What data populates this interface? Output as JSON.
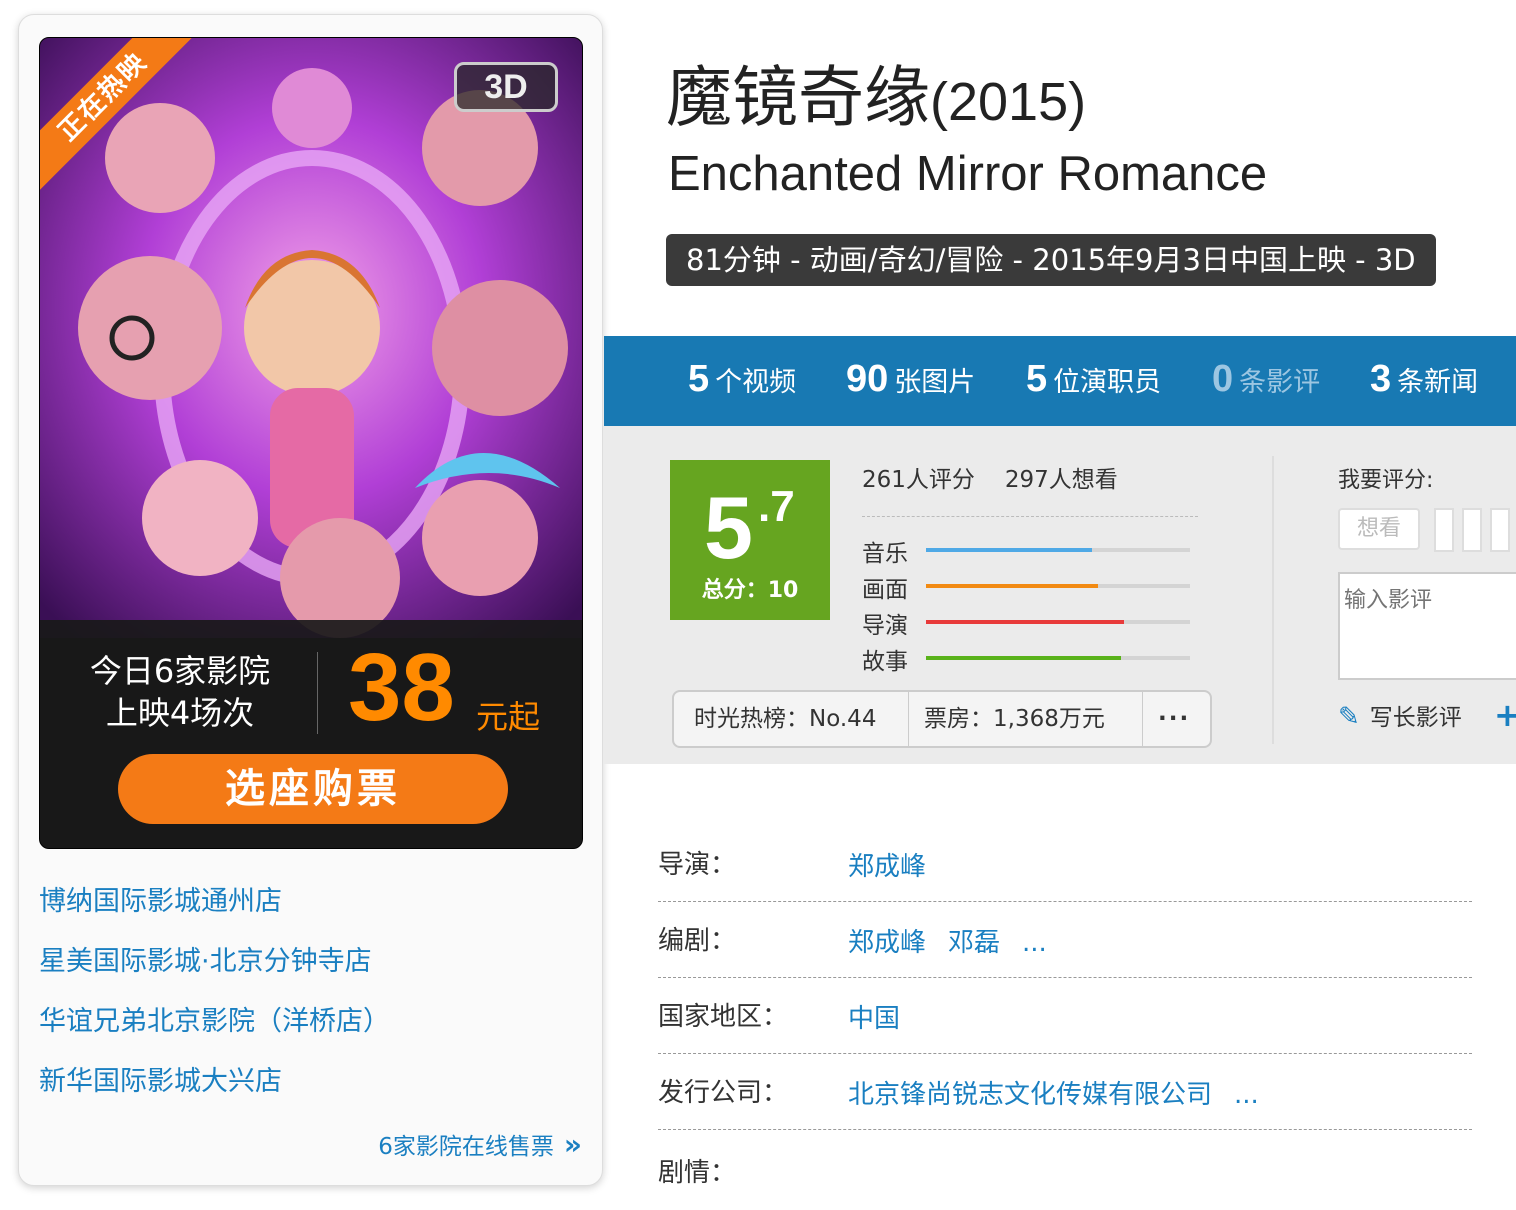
{
  "poster": {
    "ribbon": "正在热映",
    "badge": "3D",
    "showtime_line1": "今日6家影院",
    "showtime_line2": "上映4场次",
    "price": "38",
    "price_suffix": "元起",
    "buy_label": "选座购票"
  },
  "cinemas": [
    "博纳国际影城通州店",
    "星美国际影城·北京分钟寺店",
    "华谊兄弟北京影院（洋桥店）",
    "新华国际影城大兴店"
  ],
  "more_cinemas": "6家影院在线售票",
  "movie": {
    "title_cn": "魔镜奇缘",
    "year": "(2015)",
    "title_en": "Enchanted Mirror Romance",
    "meta": "81分钟 - 动画/奇幻/冒险 - 2015年9月3日中国上映 - 3D"
  },
  "stats": [
    {
      "num": "5",
      "label": "个视频"
    },
    {
      "num": "90",
      "label": "张图片"
    },
    {
      "num": "5",
      "label": "位演职员"
    },
    {
      "num": "0",
      "label": "条影评"
    },
    {
      "num": "3",
      "label": "条新闻"
    }
  ],
  "rating": {
    "score_int": "5",
    "score_dec": ".7",
    "total": "总分：10",
    "raters": "261人评分",
    "wants": "297人想看",
    "bars": [
      {
        "label": "音乐",
        "fraction": 0.63,
        "color": "#4fa9e6"
      },
      {
        "label": "画面",
        "fraction": 0.65,
        "color": "#f28a12"
      },
      {
        "label": "导演",
        "fraction": 0.75,
        "color": "#e83a3a"
      },
      {
        "label": "故事",
        "fraction": 0.74,
        "color": "#59b21a"
      }
    ],
    "hot_rank": "时光热榜：No.44",
    "box_office": "票房：1,368万元",
    "more": "···"
  },
  "my_rating": {
    "label": "我要评分:",
    "want_btn": "想看",
    "review_placeholder": "输入影评",
    "long_review": "写长影评",
    "plus": "+"
  },
  "credits": [
    {
      "key": "导演：",
      "values": [
        "郑成峰"
      ]
    },
    {
      "key": "编剧：",
      "values": [
        "郑成峰",
        "邓磊",
        "..."
      ]
    },
    {
      "key": "国家地区：",
      "values": [
        "中国"
      ]
    },
    {
      "key": "发行公司：",
      "values": [
        "北京锋尚锐志文化传媒有限公司",
        "..."
      ]
    },
    {
      "key": "剧情：",
      "values": []
    }
  ]
}
